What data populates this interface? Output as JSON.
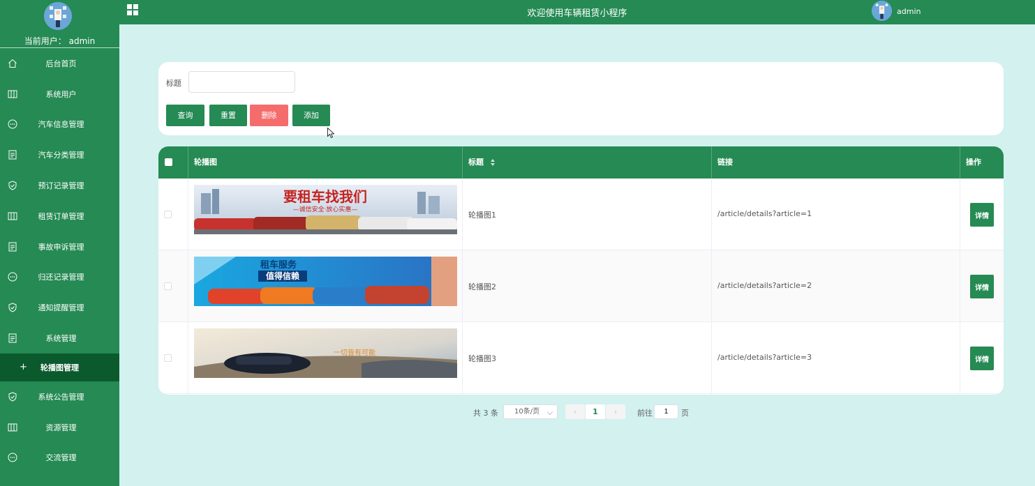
{
  "sidebar": {
    "current_user_label": "当前用户： admin",
    "items": [
      {
        "label": "后台首页",
        "icon": "home-icon"
      },
      {
        "label": "系统用户",
        "icon": "columns-icon"
      },
      {
        "label": "汽车信息管理",
        "icon": "chat-icon"
      },
      {
        "label": "汽车分类管理",
        "icon": "document-icon"
      },
      {
        "label": "预订记录管理",
        "icon": "shield-icon"
      },
      {
        "label": "租赁订单管理",
        "icon": "columns-icon"
      },
      {
        "label": "事故申诉管理",
        "icon": "document-icon"
      },
      {
        "label": "归还记录管理",
        "icon": "chat-icon"
      },
      {
        "label": "通知提醒管理",
        "icon": "shield-icon"
      },
      {
        "label": "系统管理",
        "icon": "document-icon"
      },
      {
        "label": "轮播图管理",
        "icon": "plus-icon",
        "active": true
      },
      {
        "label": "系统公告管理",
        "icon": "shield-icon"
      },
      {
        "label": "资源管理",
        "icon": "columns-icon"
      },
      {
        "label": "交流管理",
        "icon": "chat-icon"
      }
    ]
  },
  "header": {
    "title": "欢迎使用车辆租赁小程序",
    "username": "admin"
  },
  "search": {
    "title_label": "标题",
    "title_value": "",
    "query_label": "查询",
    "reset_label": "重置",
    "delete_label": "删除",
    "add_label": "添加"
  },
  "table": {
    "columns": [
      "轮播图",
      "标题",
      "链接",
      "操作"
    ],
    "rows": [
      {
        "title": "轮播图1",
        "link": "/article/details?article=1",
        "action": "详情",
        "banner_text": "要租车找我们",
        "banner_sub": "—诚信安全·放心实惠—"
      },
      {
        "title": "轮播图2",
        "link": "/article/details?article=2",
        "action": "详情",
        "banner_text": "租车服务",
        "banner_sub": "值得信赖"
      },
      {
        "title": "轮播图3",
        "link": "/article/details?article=3",
        "action": "详情",
        "banner_text": "一切皆有可能",
        "banner_sub": ""
      }
    ]
  },
  "pagination": {
    "total": "共 3 条",
    "page_size": "10条/页",
    "current_page": "1",
    "goto_label": "前往",
    "goto_value": "1",
    "page_unit": "页"
  },
  "colors": {
    "primary": "#258a53",
    "danger": "#f56c6c",
    "background": "#d2f1ef",
    "active_menu": "#0a5a2e"
  }
}
